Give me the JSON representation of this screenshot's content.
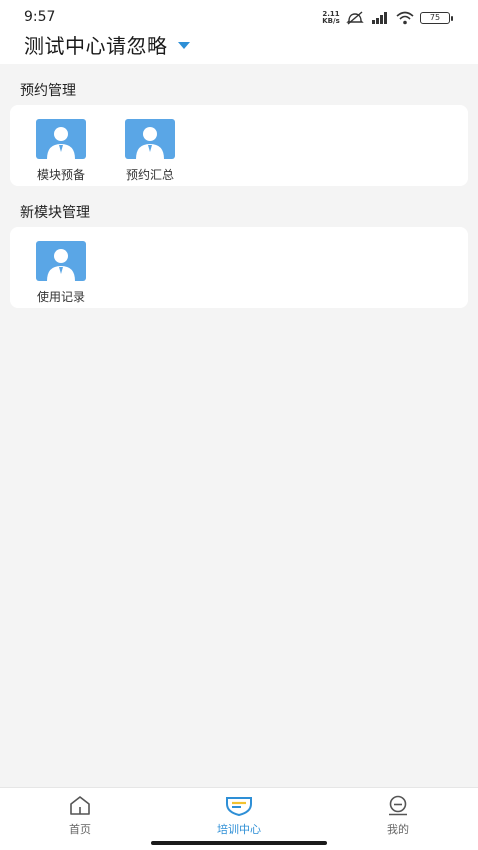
{
  "status": {
    "time": "9:57",
    "net_speed_value": "2.11",
    "net_speed_unit": "KB/s",
    "battery": "75"
  },
  "header": {
    "title": "测试中心请忽略"
  },
  "sections": [
    {
      "title": "预约管理",
      "items": [
        {
          "label": "模块预备",
          "icon": "user-avatar-icon"
        },
        {
          "label": "预约汇总",
          "icon": "user-avatar-icon"
        }
      ]
    },
    {
      "title": "新模块管理",
      "items": [
        {
          "label": "使用记录",
          "icon": "user-avatar-icon"
        }
      ]
    }
  ],
  "tabbar": {
    "tabs": [
      {
        "label": "首页",
        "icon": "home-icon"
      },
      {
        "label": "培训中心",
        "icon": "shield-icon",
        "active": true
      },
      {
        "label": "我的",
        "icon": "profile-icon"
      }
    ]
  },
  "colors": {
    "accent": "#2e8fd6",
    "avatar_bg": "#5aa6e6"
  }
}
